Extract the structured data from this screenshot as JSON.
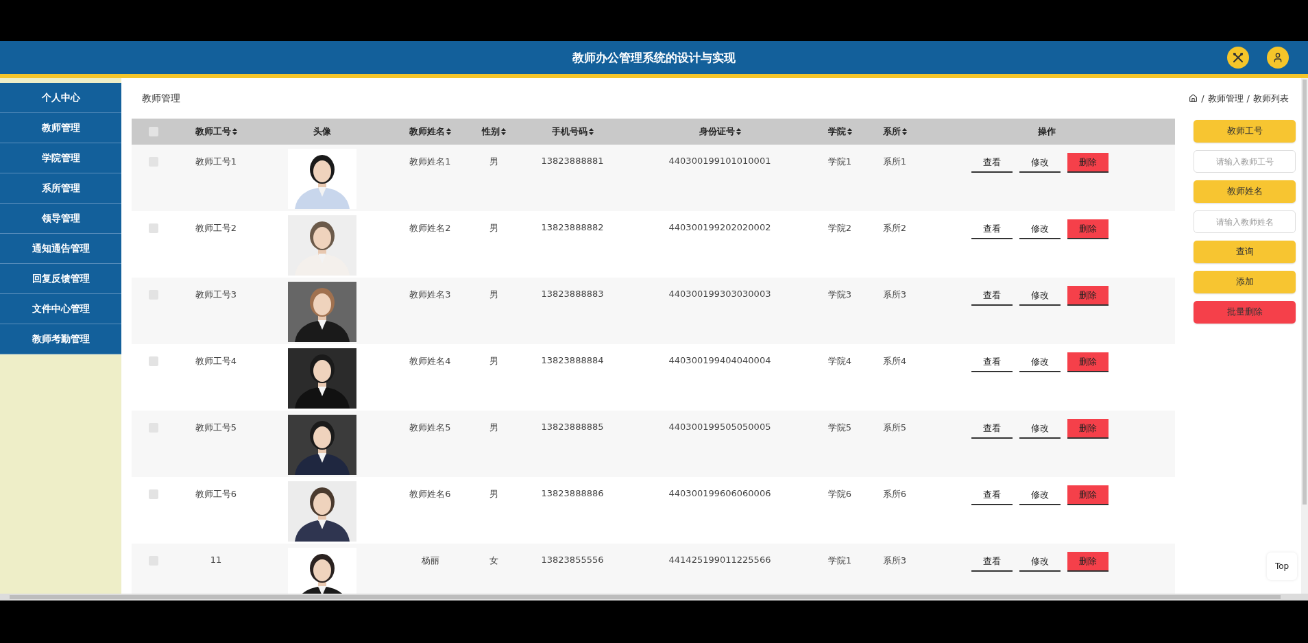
{
  "header": {
    "title": "教师办公管理系统的设计与实现"
  },
  "sidebar": {
    "items": [
      {
        "label": "个人中心",
        "selected": false
      },
      {
        "label": "教师管理",
        "selected": false
      },
      {
        "label": "学院管理",
        "selected": false
      },
      {
        "label": "系所管理",
        "selected": false
      },
      {
        "label": "领导管理",
        "selected": false
      },
      {
        "label": "通知通告管理",
        "selected": false
      },
      {
        "label": "回复反馈管理",
        "selected": false
      },
      {
        "label": "文件中心管理",
        "selected": false
      },
      {
        "label": "教师考勤管理",
        "selected": false
      }
    ]
  },
  "page_title": "教师管理",
  "breadcrumb": {
    "separator": "/",
    "items": [
      "教师管理",
      "教师列表"
    ]
  },
  "table": {
    "columns": [
      {
        "kind": "check",
        "checked": false
      },
      {
        "label": "教师工号",
        "sortable": true
      },
      {
        "label": "头像",
        "sortable": false
      },
      {
        "label": "教师姓名",
        "sortable": true
      },
      {
        "label": "性别",
        "sortable": true
      },
      {
        "label": "手机号码",
        "sortable": true
      },
      {
        "label": "身份证号",
        "sortable": true
      },
      {
        "label": "学院",
        "sortable": true
      },
      {
        "label": "系所",
        "sortable": true
      },
      {
        "label": "操作",
        "sortable": false
      }
    ],
    "rows": [
      {
        "checked": false,
        "id": "教师工号1",
        "name": "教师姓名1",
        "gender": "男",
        "phone": "13823888881",
        "id_card": "440300199101010001",
        "college": "学院1",
        "department": "系所1",
        "actions": [
          {
            "label": "查看",
            "kind": "plain"
          },
          {
            "label": "修改",
            "kind": "plain"
          },
          {
            "label": "删除",
            "kind": "danger"
          }
        ]
      },
      {
        "checked": false,
        "id": "教师工号2",
        "name": "教师姓名2",
        "gender": "男",
        "phone": "13823888882",
        "id_card": "440300199202020002",
        "college": "学院2",
        "department": "系所2",
        "actions": [
          {
            "label": "查看",
            "kind": "plain"
          },
          {
            "label": "修改",
            "kind": "plain"
          },
          {
            "label": "删除",
            "kind": "danger"
          }
        ]
      },
      {
        "checked": false,
        "id": "教师工号3",
        "name": "教师姓名3",
        "gender": "男",
        "phone": "13823888883",
        "id_card": "440300199303030003",
        "college": "学院3",
        "department": "系所3",
        "actions": [
          {
            "label": "查看",
            "kind": "plain"
          },
          {
            "label": "修改",
            "kind": "plain"
          },
          {
            "label": "删除",
            "kind": "danger"
          }
        ]
      },
      {
        "checked": false,
        "id": "教师工号4",
        "name": "教师姓名4",
        "gender": "男",
        "phone": "13823888884",
        "id_card": "440300199404040004",
        "college": "学院4",
        "department": "系所4",
        "actions": [
          {
            "label": "查看",
            "kind": "plain"
          },
          {
            "label": "修改",
            "kind": "plain"
          },
          {
            "label": "删除",
            "kind": "danger"
          }
        ]
      },
      {
        "checked": false,
        "id": "教师工号5",
        "name": "教师姓名5",
        "gender": "男",
        "phone": "13823888885",
        "id_card": "440300199505050005",
        "college": "学院5",
        "department": "系所5",
        "actions": [
          {
            "label": "查看",
            "kind": "plain"
          },
          {
            "label": "修改",
            "kind": "plain"
          },
          {
            "label": "删除",
            "kind": "danger"
          }
        ]
      },
      {
        "checked": false,
        "id": "教师工号6",
        "name": "教师姓名6",
        "gender": "男",
        "phone": "13823888886",
        "id_card": "440300199606060006",
        "college": "学院6",
        "department": "系所6",
        "actions": [
          {
            "label": "查看",
            "kind": "plain"
          },
          {
            "label": "修改",
            "kind": "plain"
          },
          {
            "label": "删除",
            "kind": "danger"
          }
        ]
      },
      {
        "checked": false,
        "id": "11",
        "name": "杨丽",
        "gender": "女",
        "phone": "13823855556",
        "id_card": "441425199011225566",
        "college": "学院1",
        "department": "系所3",
        "actions": [
          {
            "label": "查看",
            "kind": "plain"
          },
          {
            "label": "修改",
            "kind": "plain"
          },
          {
            "label": "删除",
            "kind": "danger"
          }
        ]
      }
    ]
  },
  "search_panel": [
    {
      "kind": "label",
      "text": "教师工号"
    },
    {
      "kind": "input",
      "placeholder": "请输入教师工号"
    },
    {
      "kind": "label",
      "text": "教师姓名"
    },
    {
      "kind": "input",
      "placeholder": "请输入教师姓名"
    },
    {
      "kind": "button",
      "text": "查询"
    },
    {
      "kind": "button",
      "text": "添加"
    },
    {
      "kind": "danger",
      "text": "批量删除"
    }
  ],
  "top_button": "Top"
}
